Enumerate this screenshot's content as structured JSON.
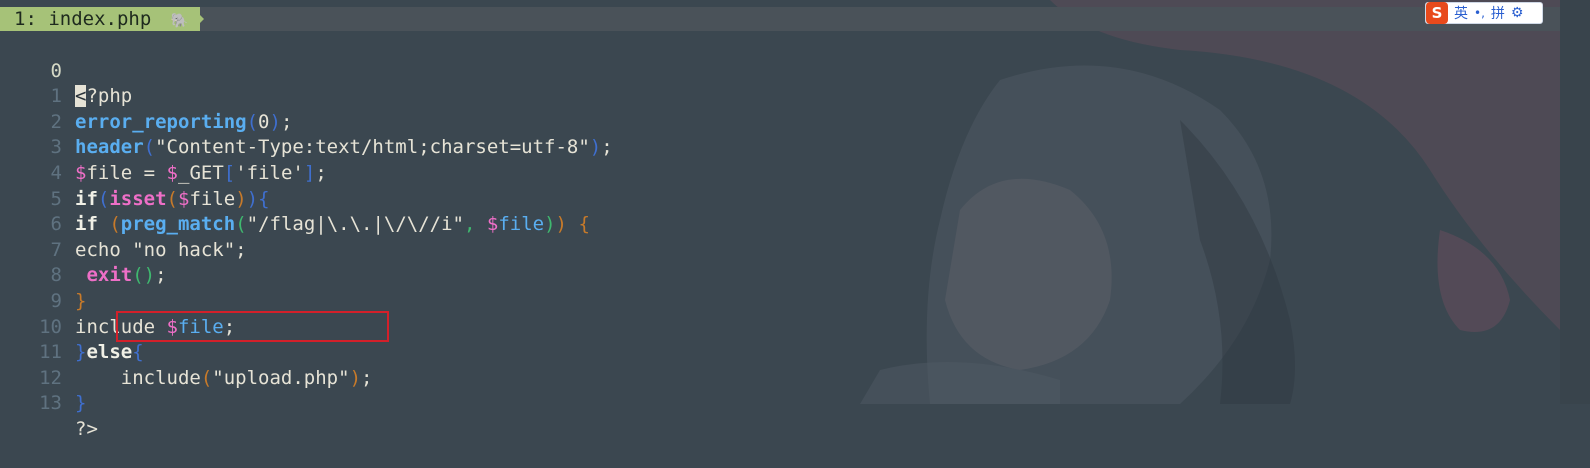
{
  "tab": {
    "label": "1: index.php"
  },
  "ime": {
    "logo": "S",
    "mode": "英",
    "punct": "•,",
    "input": "拼"
  },
  "lines": [
    {
      "n": "0"
    },
    {
      "n": "1"
    },
    {
      "n": "2"
    },
    {
      "n": "3"
    },
    {
      "n": "4"
    },
    {
      "n": "5"
    },
    {
      "n": "6"
    },
    {
      "n": "7"
    },
    {
      "n": "8"
    },
    {
      "n": "9"
    },
    {
      "n": "10"
    },
    {
      "n": "11"
    },
    {
      "n": "12"
    },
    {
      "n": "13"
    }
  ],
  "code": {
    "l0_cursor": "<",
    "l0_rest": "?php",
    "l1_fn": "error_reporting",
    "l1_open": "(",
    "l1_arg": "0",
    "l1_close": ")",
    "l1_end": ";",
    "l2_fn": "header",
    "l2_open": "(",
    "l2_str": "\"Content-Type:text/html;charset=utf-8\"",
    "l2_close": ")",
    "l2_end": ";",
    "l3_dollar": "$",
    "l3_var": "file",
    "l3_mid": " = ",
    "l3_dollar2": "$",
    "l3_get": "_GET",
    "l3_lb": "[",
    "l3_key": "'file'",
    "l3_rb": "]",
    "l3_end": ";",
    "l4_if": "if",
    "l4_open": "(",
    "l4_fn": "isset",
    "l4_open2": "(",
    "l4_dollar": "$",
    "l4_var": "file",
    "l4_close2": ")",
    "l4_close": ")",
    "l4_brace": "{",
    "l5_if": "if",
    "l5_sp": " ",
    "l5_open": "(",
    "l5_fn": "preg_match",
    "l5_open2": "(",
    "l5_str": "\"/flag|\\.\\.|\\/\\//i\"",
    "l5_comma": ", ",
    "l5_dollar": "$",
    "l5_var": "file",
    "l5_close2": ")",
    "l5_close": ")",
    "l5_brace": " {",
    "l6": "echo \"no hack\";",
    "l7_sp": " ",
    "l7_exit": "exit",
    "l7_parens": "()",
    "l7_end": ";",
    "l8": "}",
    "l9_pre": "include ",
    "l9_dollar": "$",
    "l9_var": "file",
    "l9_end": ";",
    "l10_brace": "}",
    "l10_else": "else",
    "l10_brace2": "{",
    "l11_indent": "    ",
    "l11_inc": "include",
    "l11_open": "(",
    "l11_str": "\"upload.php\"",
    "l11_close": ")",
    "l11_end": ";",
    "l12": "}",
    "l13": "?>"
  },
  "colors": {
    "background": "#3b4750",
    "tab_active": "#a6c278",
    "highlight_box": "#d3202a",
    "function": "#5aaef0",
    "keyword_exit": "#ee6fc7"
  }
}
